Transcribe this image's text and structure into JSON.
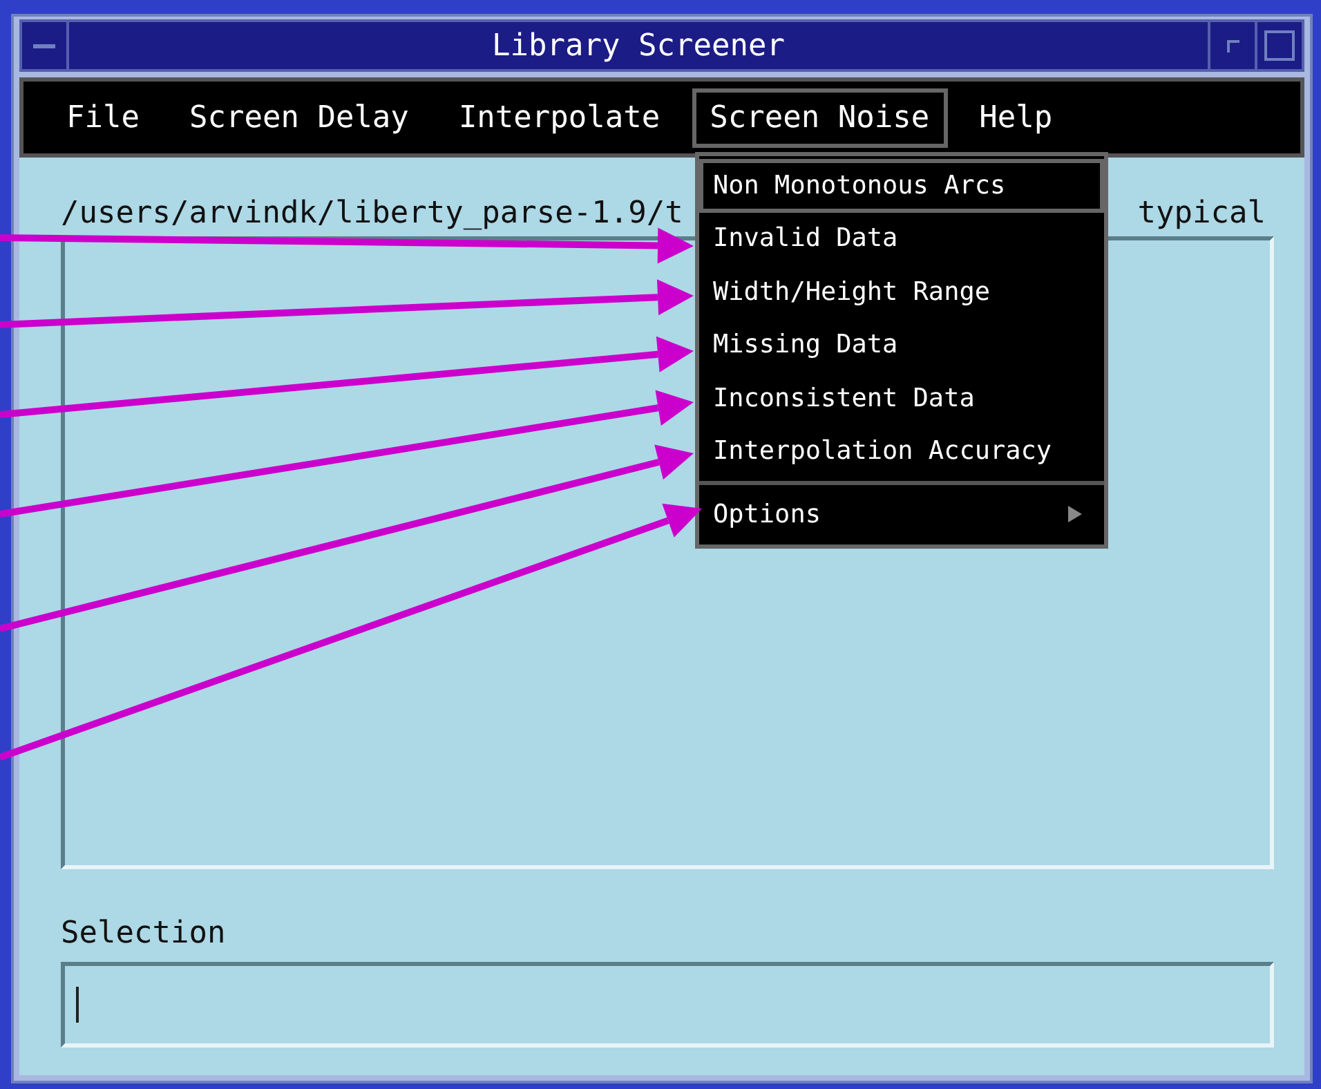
{
  "window": {
    "title": "Library Screener"
  },
  "menubar": [
    {
      "label": "File",
      "selected": false
    },
    {
      "label": "Screen Delay",
      "selected": false
    },
    {
      "label": "Interpolate",
      "selected": false
    },
    {
      "label": "Screen Noise",
      "selected": true
    },
    {
      "label": "Help",
      "selected": false
    }
  ],
  "dropdown": {
    "items": [
      {
        "label": "Non Monotonous Arcs",
        "selected": true,
        "annotated": false,
        "submenu": false
      },
      {
        "label": "Invalid Data",
        "selected": false,
        "annotated": true,
        "submenu": false
      },
      {
        "label": "Width/Height Range",
        "selected": false,
        "annotated": true,
        "submenu": false
      },
      {
        "label": "Missing Data",
        "selected": false,
        "annotated": true,
        "submenu": false
      },
      {
        "label": "Inconsistent Data",
        "selected": false,
        "annotated": true,
        "submenu": false
      },
      {
        "label": "Interpolation Accuracy",
        "selected": false,
        "annotated": true,
        "submenu": false
      },
      {
        "label": "Options",
        "selected": false,
        "annotated": true,
        "submenu": true
      }
    ]
  },
  "path_label": {
    "start": "/users/arvindk/liberty_parse-1.9/t",
    "end": "typical"
  },
  "selection": {
    "label": "Selection"
  }
}
